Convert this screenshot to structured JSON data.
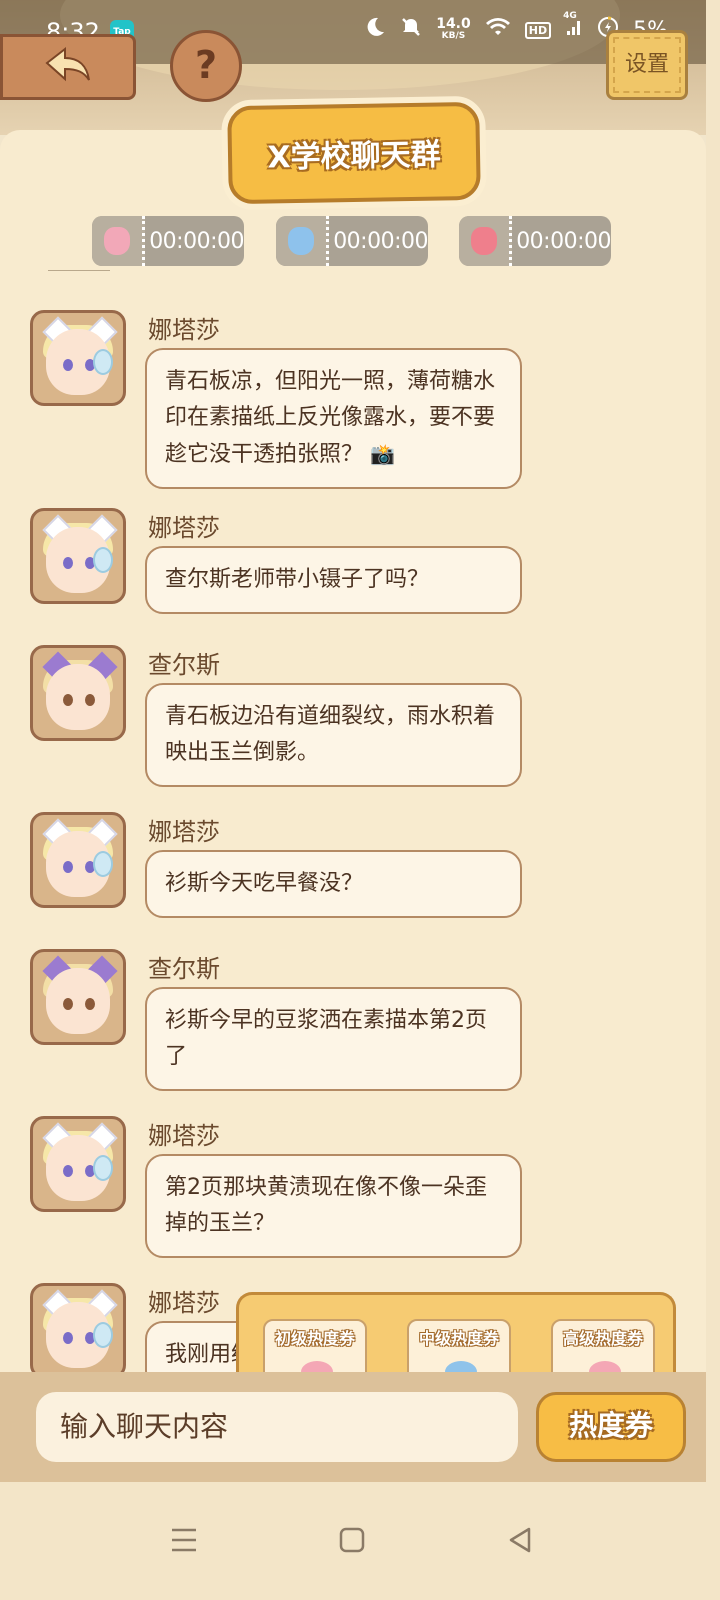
{
  "status_bar": {
    "time": "8:32",
    "tap_badge": "Tap",
    "net_speed_value": "14.0",
    "net_speed_unit": "KB/S",
    "hd_label": "HD",
    "signal_label": "4G",
    "battery": "5%"
  },
  "header": {
    "settings_label": "设置",
    "help_label": "?"
  },
  "title": "X学校聊天群",
  "timers": [
    {
      "value": "00:00:00",
      "color": "#f2a8b8"
    },
    {
      "value": "00:00:00",
      "color": "#8ec2ec"
    },
    {
      "value": "00:00:00",
      "color": "#ef7f8c"
    }
  ],
  "messages": [
    {
      "sender": "娜塔莎",
      "avatar": "natasha",
      "text": "青石板凉，但阳光一照，薄荷糖水印在素描纸上反光像露水，要不要趁它没干透拍张照？",
      "emoji": "📸"
    },
    {
      "sender": "娜塔莎",
      "avatar": "natasha",
      "text": "查尔斯老师带小镊子了吗？"
    },
    {
      "sender": "查尔斯",
      "avatar": "charles",
      "text": "青石板边沿有道细裂纹，雨水积着映出玉兰倒影。"
    },
    {
      "sender": "娜塔莎",
      "avatar": "natasha",
      "text": "衫斯今天吃早餐没？"
    },
    {
      "sender": "查尔斯",
      "avatar": "charles",
      "text": "衫斯今早的豆浆洒在素描本第2页了"
    },
    {
      "sender": "娜塔莎",
      "avatar": "natasha",
      "text": "第2页那块黄渍现在像不像一朵歪掉的玉兰？"
    },
    {
      "sender": "娜塔莎",
      "avatar": "natasha",
      "text": "我刚用统"
    }
  ],
  "coupons": [
    {
      "label": "初级热度券"
    },
    {
      "label": "中级热度券"
    },
    {
      "label": "高级热度券"
    }
  ],
  "input": {
    "placeholder": "输入聊天内容",
    "heat_button": "热度券"
  }
}
